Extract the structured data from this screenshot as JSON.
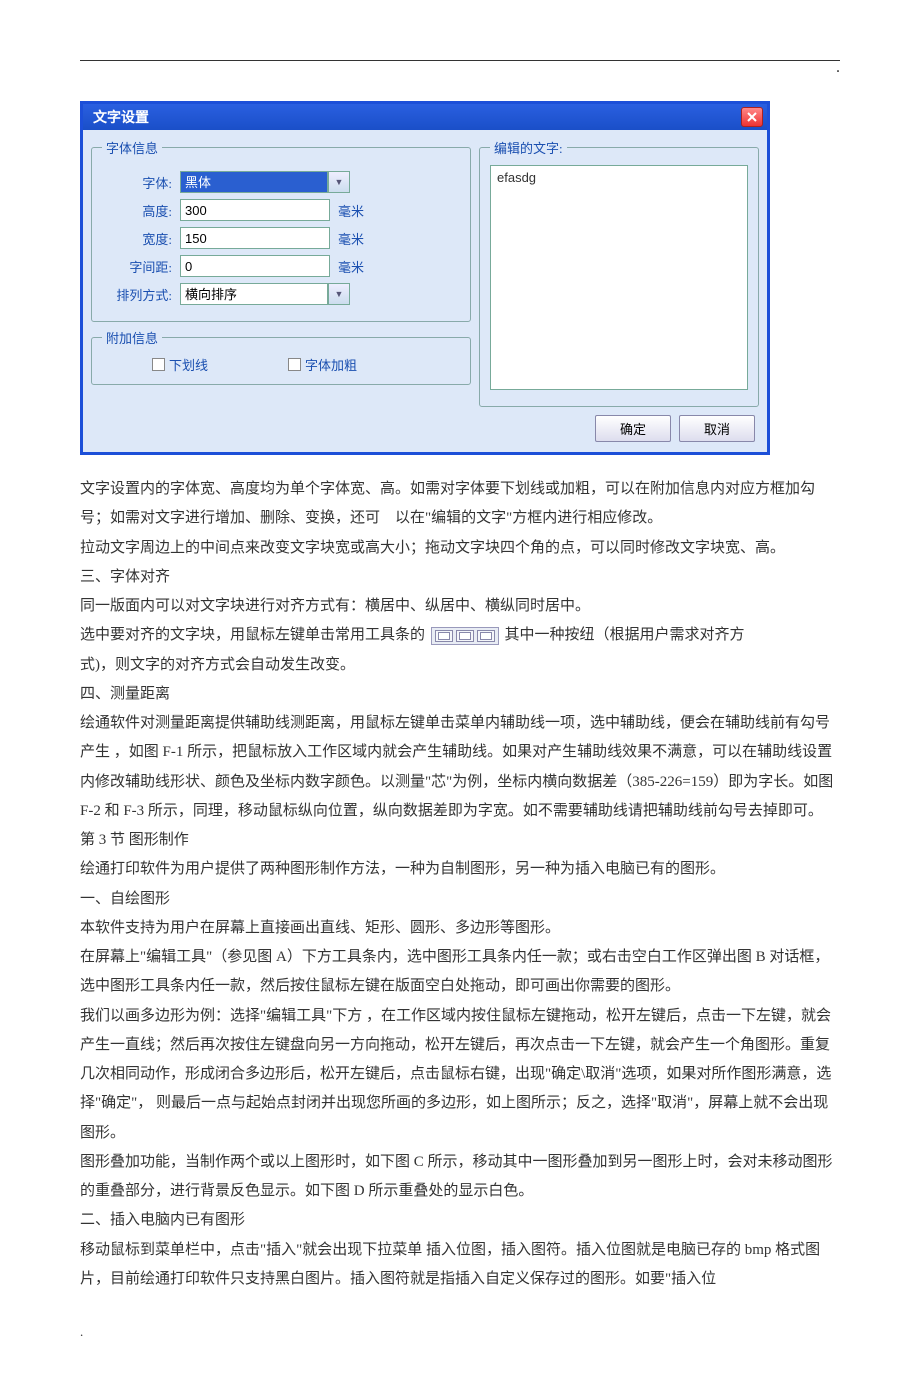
{
  "dialog": {
    "title": "文字设置",
    "fontInfo": {
      "legend": "字体信息",
      "font": {
        "label": "字体:",
        "value": "黑体"
      },
      "height": {
        "label": "高度:",
        "value": "300",
        "unit": "毫米"
      },
      "width": {
        "label": "宽度:",
        "value": "150",
        "unit": "毫米"
      },
      "spacing": {
        "label": "字间距:",
        "value": "0",
        "unit": "毫米"
      },
      "arrange": {
        "label": "排列方式:",
        "value": "横向排序"
      }
    },
    "extra": {
      "legend": "附加信息",
      "underline": "下划线",
      "bold": "字体加粗"
    },
    "editText": {
      "legend": "编辑的文字:",
      "value": "efasdg"
    },
    "ok": "确定",
    "cancel": "取消"
  },
  "article": {
    "p1": "文字设置内的字体宽、高度均为单个字体宽、高。如需对字体要下划线或加粗，可以在附加信息内对应方框加勾号；如需对文字进行增加、删除、变换，还可　以在\"编辑的文字\"方框内进行相应修改。",
    "p2": "拉动文字周边上的中间点来改变文字块宽或高大小；拖动文字块四个角的点，可以同时修改文字块宽、高。",
    "p3": "三、字体对齐",
    "p4": "同一版面内可以对文字块进行对齐方式有：横居中、纵居中、横纵同时居中。",
    "p5a": "选中要对齐的文字块，用鼠标左键单击常用工具条的",
    "p5b": "其中一种按纽（根据用户需求对齐方",
    "p6": "式)，则文字的对齐方式会自动发生改变。",
    "p7": "四、测量距离",
    "p8": "绘通软件对测量距离提供辅助线测距离，用鼠标左键单击菜单内辅助线一项，选中辅助线，便会在辅助线前有勾号产生 ，如图 F-1 所示，把鼠标放入工作区域内就会产生辅助线。如果对产生辅助线效果不满意，可以在辅助线设置内修改辅助线形状、颜色及坐标内数字颜色。以测量\"芯\"为例，坐标内横向数据差（385-226=159）即为字长。如图 F-2 和 F-3 所示，同理，移动鼠标纵向位置，纵向数据差即为字宽。如不需要辅助线请把辅助线前勾号去掉即可。",
    "p9": "第 3 节  图形制作",
    "p10": "绘通打印软件为用户提供了两种图形制作方法，一种为自制图形，另一种为插入电脑已有的图形。",
    "p11": "一、自绘图形",
    "p12": "本软件支持为用户在屏幕上直接画出直线、矩形、圆形、多边形等图形。",
    "p13": "在屏幕上\"编辑工具\"（参见图 A）下方工具条内，选中图形工具条内任一款；或右击空白工作区弹出图 B 对话框，选中图形工具条内任一款，然后按住鼠标左键在版面空白处拖动，即可画出你需要的图形。",
    "p14": "我们以画多边形为例：选择\"编辑工具\"下方 ，在工作区域内按住鼠标左键拖动，松开左键后，点击一下左键，就会产生一直线；然后再次按住左键盘向另一方向拖动，松开左键后，再次点击一下左键，就会产生一个角图形。重复几次相同动作，形成闭合多边形后，松开左键后，点击鼠标右键，出现\"确定\\取消\"选项，如果对所作图形满意，选择\"确定\"， 则最后一点与起始点封闭并出现您所画的多边形，如上图所示；反之，选择\"取消\"，屏幕上就不会出现图形。",
    "p15": "图形叠加功能，当制作两个或以上图形时，如下图 C 所示，移动其中一图形叠加到另一图形上时，会对未移动图形的重叠部分，进行背景反色显示。如下图 D 所示重叠处的显示白色。",
    "p16": "二、插入电脑内已有图形",
    "p17": "移动鼠标到菜单栏中，点击\"插入\"就会出现下拉菜单 插入位图，插入图符。插入位图就是电脑已存的 bmp 格式图片，目前绘通打印软件只支持黑白图片。插入图符就是指插入自定义保存过的图形。如要\"插入位"
  }
}
